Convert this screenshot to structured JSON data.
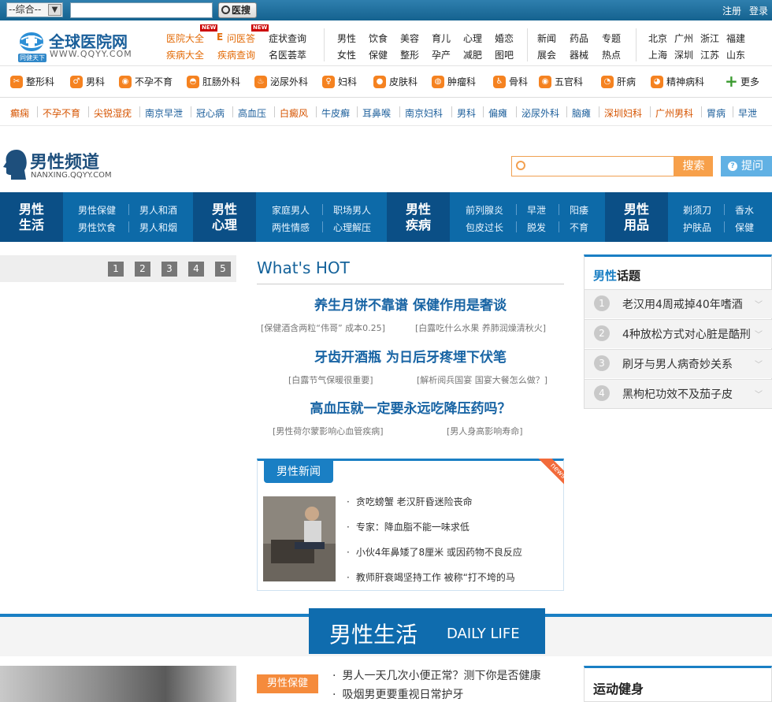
{
  "topbar": {
    "select_value": "--综合--",
    "search_placeholder": "",
    "search_button": "医搜",
    "register": "注册",
    "login": "登录"
  },
  "logo": {
    "name": "全球医院网",
    "url": "WWW.QQYY.COM",
    "slogan": "同健天下"
  },
  "top_links": {
    "col1": [
      "医院大全",
      "疾病大全"
    ],
    "col2": [
      "问医答",
      "疾病查询"
    ],
    "col3": [
      "症状查询",
      "名医荟萃"
    ],
    "new_badge": "NEW",
    "grid1": [
      [
        "男性",
        "饮食",
        "美容",
        "育儿",
        "心理",
        "婚恋"
      ],
      [
        "女性",
        "保健",
        "整形",
        "孕产",
        "减肥",
        "图吧"
      ]
    ],
    "grid2": [
      [
        "新闻",
        "药品",
        "专题"
      ],
      [
        "展会",
        "器械",
        "热点"
      ]
    ],
    "grid3": [
      [
        "北京",
        "广州",
        "浙江",
        "福建"
      ],
      [
        "上海",
        "深圳",
        "江苏",
        "山东"
      ]
    ]
  },
  "categories": [
    "整形科",
    "男科",
    "不孕不育",
    "肛肠外科",
    "泌尿外科",
    "妇科",
    "皮肤科",
    "肿瘤科",
    "骨科",
    "五官科",
    "肝病",
    "精神病科",
    "更多"
  ],
  "tags": [
    "癫痫",
    "不孕不育",
    "尖锐湿疣",
    "南京早泄",
    "冠心病",
    "高血压",
    "白癜风",
    "牛皮癣",
    "耳鼻喉",
    "南京妇科",
    "男科",
    "偏瘫",
    "泌尿外科",
    "脑瘫",
    "深圳妇科",
    "广州男科",
    "胃病",
    "早泄"
  ],
  "channel": {
    "title": "男性频道",
    "url": "NANXING.QQYY.COM",
    "search_placeholder": "",
    "search_button": "搜索",
    "ask_button": "提问"
  },
  "nav": [
    {
      "title": "男性\n生活",
      "links": [
        [
          "男性保健",
          "男人和酒"
        ],
        [
          "男性饮食",
          "男人和烟"
        ]
      ]
    },
    {
      "title": "男性\n心理",
      "links": [
        [
          "家庭男人",
          "职场男人"
        ],
        [
          "两性情感",
          "心理解压"
        ]
      ]
    },
    {
      "title": "男性\n疾病",
      "links": [
        [
          "前列腺炎",
          "早泄",
          "阳痿"
        ],
        [
          "包皮过长",
          "脱发",
          "不育"
        ]
      ]
    },
    {
      "title": "男性\n用品",
      "links": [
        [
          "剃须刀",
          "香水"
        ],
        [
          "护肤品",
          "保健"
        ]
      ]
    }
  ],
  "slider_pages": [
    "1",
    "2",
    "3",
    "4",
    "5"
  ],
  "hot": {
    "title": "What's HOT",
    "headlines": [
      {
        "title": "养生月饼不靠谱 保健作用是奢谈",
        "subs": [
          "[保健酒含两粒“伟哥” 成本0.25]",
          "[白露吃什么水果 养肺润燥清秋火]"
        ]
      },
      {
        "title": "牙齿开酒瓶 为日后牙疼埋下伏笔",
        "subs": [
          "[白露节气保暖很重要]",
          "[解析阅兵国宴 国宴大餐怎么做？]"
        ]
      },
      {
        "title": "高血压就一定要永远吃降压药吗？",
        "subs": [
          "[男性荷尔蒙影响心血管疾病]",
          "[男人身高影响寿命]"
        ]
      }
    ]
  },
  "news": {
    "tab": "男性新闻",
    "ribbon": "news",
    "items": [
      "贪吃螃蟹 老汉肝昏迷险丧命",
      "专家：降血脂不能一味求低",
      "小伙4年鼻矮了8厘米 或因药物不良反应",
      "教师肝衰竭坚持工作 被称“打不垮的马"
    ]
  },
  "topics": {
    "title_accent": "男性",
    "title_rest": "话题",
    "items": [
      {
        "num": "1",
        "text": "老汉用4周戒掉40年嗜酒"
      },
      {
        "num": "2",
        "text": "4种放松方式对心脏是酷刑"
      },
      {
        "num": "3",
        "text": "刷牙与男人病奇妙关系"
      },
      {
        "num": "4",
        "text": "黑枸杞功效不及茄子皮"
      }
    ]
  },
  "section": {
    "zh": "男性生活",
    "en": "DAILY LIFE"
  },
  "bottom": {
    "tag": "男性保健",
    "items": [
      "男人一天几次小便正常？测下你是否健康",
      "吸烟男更要重视日常护牙"
    ],
    "sport_title": "运动健身"
  },
  "colors": {
    "primary": "#0d6aa8",
    "accent_orange": "#f58b3c",
    "tag_orange": "#d65400"
  }
}
